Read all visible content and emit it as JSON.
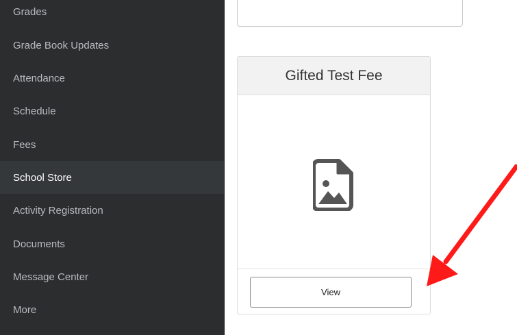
{
  "sidebar": {
    "items": [
      {
        "label": "Grades"
      },
      {
        "label": "Grade Book Updates"
      },
      {
        "label": "Attendance"
      },
      {
        "label": "Schedule"
      },
      {
        "label": "Fees"
      },
      {
        "label": "School Store",
        "active": true
      },
      {
        "label": "Activity Registration"
      },
      {
        "label": "Documents"
      },
      {
        "label": "Message Center"
      },
      {
        "label": "More"
      }
    ]
  },
  "store": {
    "card": {
      "title": "Gifted Test Fee",
      "image_icon": "image-placeholder-icon",
      "view_label": "View"
    }
  },
  "annotation": {
    "arrow_color": "#ff1a1a",
    "arrow_icon": "red-arrow-pointing-to-view-button"
  },
  "colors": {
    "sidebar_bg": "#2b2d2f",
    "sidebar_active_bg": "#35383b",
    "sidebar_text": "#b9bcbf"
  }
}
